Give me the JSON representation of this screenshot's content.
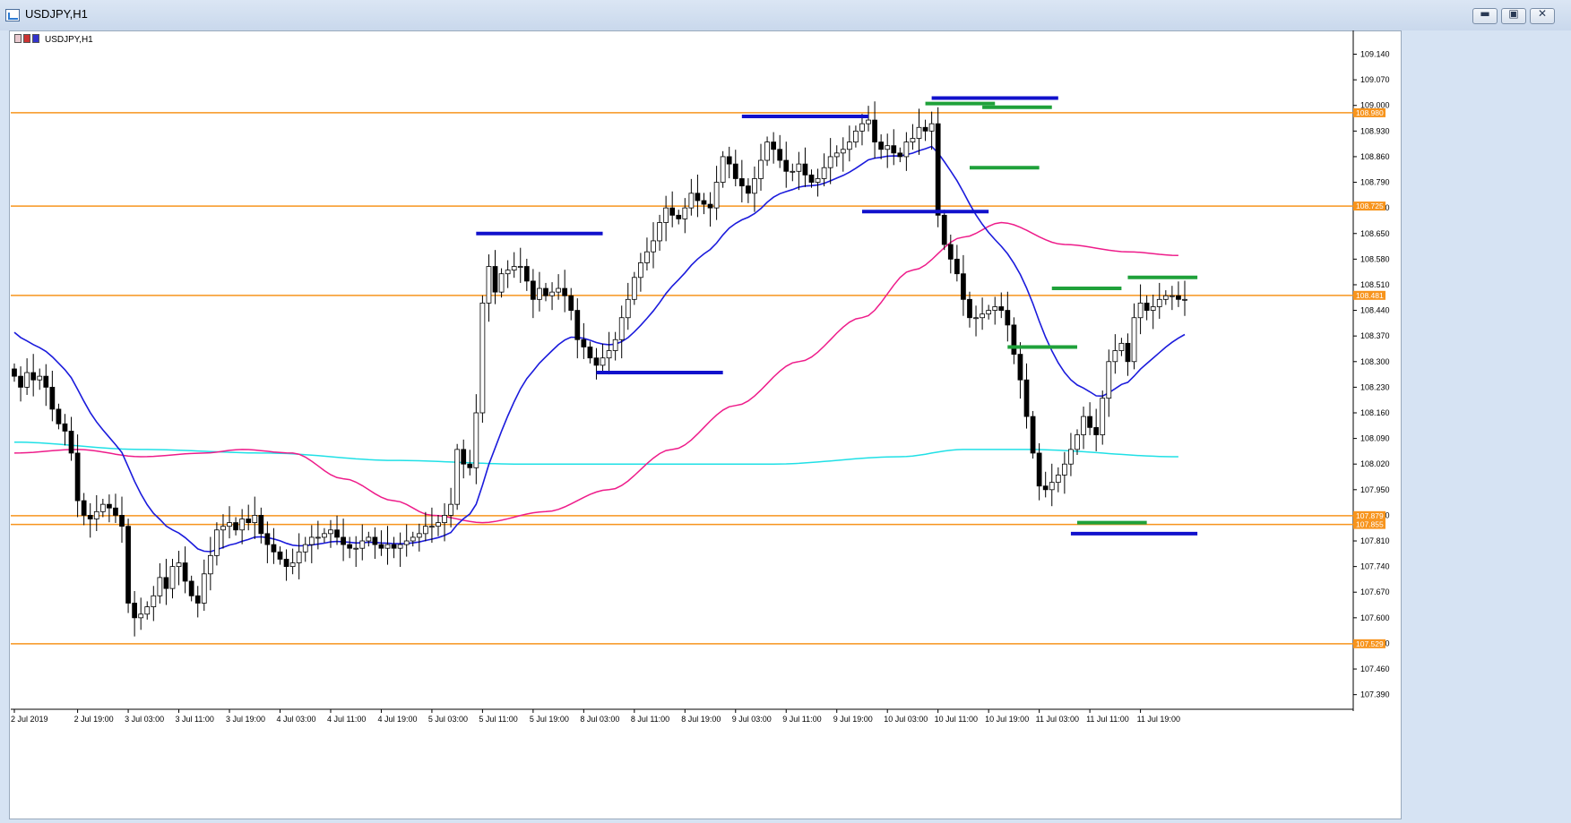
{
  "window": {
    "title": "USDJPY,H1",
    "controls": {
      "minimize": "▬",
      "restore": "▣",
      "close": "✕"
    }
  },
  "chart_label": "USDJPY,H1",
  "colors": {
    "bull": "#ffffff",
    "bear": "#000000",
    "wick": "#000000",
    "level_line": "#f7941d",
    "level_tag_bg": "#f7941d",
    "level_tag_text": "#ffffff",
    "ma_fast": "#1b1bdc",
    "ma_mid": "#ee1c8a",
    "ma_slow": "#20e0e6",
    "resistance_marker": "#1111cc",
    "support_marker": "#1fa13a",
    "grid_text": "#000000"
  },
  "chart_data": {
    "type": "candlestick",
    "symbol": "USDJPY",
    "timeframe": "H1",
    "ylim": [
      107.35,
      109.2
    ],
    "y_ticks": [
      "109.140",
      "109.070",
      "109.000",
      "108.930",
      "108.860",
      "108.790",
      "108.720",
      "108.650",
      "108.580",
      "108.510",
      "108.440",
      "108.370",
      "108.300",
      "108.230",
      "108.160",
      "108.090",
      "108.020",
      "107.950",
      "107.880",
      "107.810",
      "107.740",
      "107.670",
      "107.600",
      "107.530",
      "107.460",
      "107.390"
    ],
    "x_ticks": [
      {
        "label": "2 Jul 2019",
        "bar": 0
      },
      {
        "label": "2 Jul 19:00",
        "bar": 10
      },
      {
        "label": "3 Jul 03:00",
        "bar": 18
      },
      {
        "label": "3 Jul 11:00",
        "bar": 26
      },
      {
        "label": "3 Jul 19:00",
        "bar": 34
      },
      {
        "label": "4 Jul 03:00",
        "bar": 42
      },
      {
        "label": "4 Jul 11:00",
        "bar": 50
      },
      {
        "label": "4 Jul 19:00",
        "bar": 58
      },
      {
        "label": "5 Jul 03:00",
        "bar": 66
      },
      {
        "label": "5 Jul 11:00",
        "bar": 74
      },
      {
        "label": "5 Jul 19:00",
        "bar": 82
      },
      {
        "label": "8 Jul 03:00",
        "bar": 90
      },
      {
        "label": "8 Jul 11:00",
        "bar": 98
      },
      {
        "label": "8 Jul 19:00",
        "bar": 106
      },
      {
        "label": "9 Jul 03:00",
        "bar": 114
      },
      {
        "label": "9 Jul 11:00",
        "bar": 122
      },
      {
        "label": "9 Jul 19:00",
        "bar": 130
      },
      {
        "label": "10 Jul 03:00",
        "bar": 138
      },
      {
        "label": "10 Jul 11:00",
        "bar": 146
      },
      {
        "label": "10 Jul 19:00",
        "bar": 154
      },
      {
        "label": "11 Jul 03:00",
        "bar": 162
      },
      {
        "label": "11 Jul 11:00",
        "bar": 170
      },
      {
        "label": "11 Jul 19:00",
        "bar": 178
      }
    ],
    "levels": [
      {
        "price": 108.98,
        "label": "108.980"
      },
      {
        "price": 108.725,
        "label": "108.725"
      },
      {
        "price": 108.481,
        "label": "108.481"
      },
      {
        "price": 107.879,
        "label": "107.879"
      },
      {
        "price": 107.855,
        "label": "107.855"
      },
      {
        "price": 107.529,
        "label": "107.529"
      }
    ],
    "close_series": [
      108.26,
      108.23,
      108.27,
      108.25,
      108.26,
      108.23,
      108.17,
      108.13,
      108.11,
      108.05,
      107.92,
      107.88,
      107.87,
      107.89,
      107.91,
      107.9,
      107.88,
      107.85,
      107.64,
      107.6,
      107.61,
      107.63,
      107.66,
      107.71,
      107.68,
      107.74,
      107.75,
      107.7,
      107.66,
      107.64,
      107.72,
      107.77,
      107.84,
      107.85,
      107.86,
      107.84,
      107.87,
      107.86,
      107.88,
      107.83,
      107.8,
      107.78,
      107.76,
      107.74,
      107.75,
      107.78,
      107.8,
      107.82,
      107.82,
      107.83,
      107.84,
      107.82,
      107.8,
      107.79,
      107.79,
      107.81,
      107.82,
      107.8,
      107.79,
      107.8,
      107.79,
      107.8,
      107.81,
      107.82,
      107.83,
      107.85,
      107.85,
      107.86,
      107.88,
      107.91,
      108.06,
      108.02,
      108.01,
      108.16,
      108.46,
      108.56,
      108.49,
      108.54,
      108.55,
      108.56,
      108.56,
      108.52,
      108.47,
      108.5,
      108.48,
      108.49,
      108.5,
      108.48,
      108.44,
      108.36,
      108.34,
      108.31,
      108.29,
      108.31,
      108.33,
      108.36,
      108.42,
      108.47,
      108.53,
      108.57,
      108.6,
      108.63,
      108.68,
      108.72,
      108.7,
      108.69,
      108.72,
      108.76,
      108.74,
      108.73,
      108.72,
      108.79,
      108.86,
      108.84,
      108.8,
      108.78,
      108.76,
      108.8,
      108.85,
      108.9,
      108.88,
      108.85,
      108.82,
      108.82,
      108.84,
      108.81,
      108.79,
      108.8,
      108.83,
      108.86,
      108.87,
      108.88,
      108.9,
      108.93,
      108.95,
      108.96,
      108.9,
      108.88,
      108.89,
      108.87,
      108.86,
      108.9,
      108.91,
      108.94,
      108.93,
      108.95,
      108.7,
      108.62,
      108.58,
      108.54,
      108.47,
      108.42,
      108.42,
      108.43,
      108.44,
      108.45,
      108.44,
      108.4,
      108.32,
      108.25,
      108.15,
      108.05,
      107.96,
      107.95,
      107.97,
      107.99,
      108.02,
      108.06,
      108.1,
      108.15,
      108.12,
      108.1,
      108.2,
      108.3,
      108.33,
      108.35,
      108.3,
      108.42,
      108.46,
      108.44,
      108.45,
      108.47,
      108.48,
      108.48,
      108.47,
      108.47
    ],
    "ma_mid_ctrl": [
      [
        0,
        108.05
      ],
      [
        10,
        108.06
      ],
      [
        20,
        108.04
      ],
      [
        30,
        108.05
      ],
      [
        36,
        108.06
      ],
      [
        44,
        108.05
      ],
      [
        52,
        107.98
      ],
      [
        60,
        107.92
      ],
      [
        66,
        107.88
      ],
      [
        74,
        107.86
      ],
      [
        84,
        107.89
      ],
      [
        94,
        107.95
      ],
      [
        104,
        108.06
      ],
      [
        114,
        108.18
      ],
      [
        124,
        108.3
      ],
      [
        134,
        108.42
      ],
      [
        142,
        108.55
      ],
      [
        150,
        108.64
      ],
      [
        156,
        108.68
      ],
      [
        166,
        108.62
      ],
      [
        176,
        108.6
      ],
      [
        184,
        108.59
      ]
    ],
    "ma_slow_ctrl": [
      [
        0,
        108.08
      ],
      [
        20,
        108.06
      ],
      [
        40,
        108.05
      ],
      [
        60,
        108.03
      ],
      [
        80,
        108.02
      ],
      [
        100,
        108.02
      ],
      [
        120,
        108.02
      ],
      [
        140,
        108.04
      ],
      [
        150,
        108.06
      ],
      [
        160,
        108.06
      ],
      [
        184,
        108.04
      ]
    ],
    "ma_fast_from_bar": 0,
    "markers": [
      {
        "kind": "resistance",
        "bar_start": 73,
        "bar_end": 93,
        "price": 108.65
      },
      {
        "kind": "support",
        "bar_start": 92,
        "bar_end": 112,
        "price": 108.27
      },
      {
        "kind": "resistance",
        "bar_start": 115,
        "bar_end": 135,
        "price": 108.97
      },
      {
        "kind": "support",
        "bar_start": 134,
        "bar_end": 154,
        "price": 108.71
      },
      {
        "kind": "resistance",
        "bar_start": 145,
        "bar_end": 165,
        "price": 109.02
      },
      {
        "kind": "green",
        "bar_start": 144,
        "bar_end": 155,
        "price": 109.005
      },
      {
        "kind": "green",
        "bar_start": 153,
        "bar_end": 164,
        "price": 108.995
      },
      {
        "kind": "green",
        "bar_start": 151,
        "bar_end": 162,
        "price": 108.83
      },
      {
        "kind": "green",
        "bar_start": 164,
        "bar_end": 175,
        "price": 108.5
      },
      {
        "kind": "green",
        "bar_start": 157,
        "bar_end": 168,
        "price": 108.34
      },
      {
        "kind": "green",
        "bar_start": 168,
        "bar_end": 179,
        "price": 107.86
      },
      {
        "kind": "resistance",
        "bar_start": 167,
        "bar_end": 187,
        "price": 107.83
      },
      {
        "kind": "green",
        "bar_start": 176,
        "bar_end": 187,
        "price": 108.53
      }
    ]
  }
}
